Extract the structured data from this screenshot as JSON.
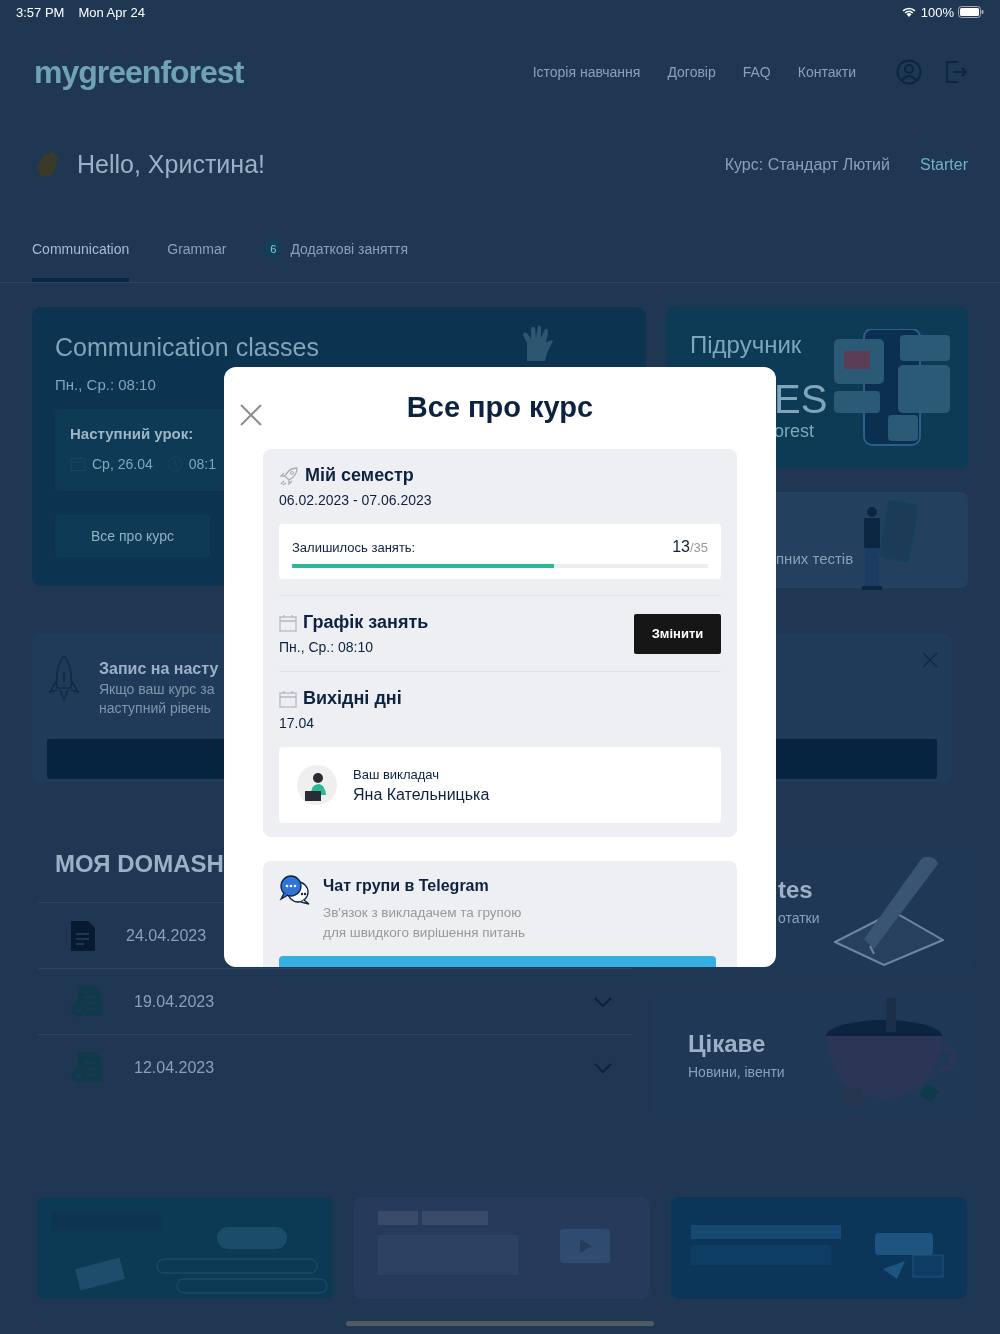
{
  "status_bar": {
    "time": "3:57 PM",
    "date": "Mon Apr 24",
    "battery": "100%"
  },
  "header": {
    "logo": "mygreenforest",
    "nav": [
      "Історія навчання",
      "Договір",
      "FAQ",
      "Контакти"
    ]
  },
  "greeting": {
    "text": "Hello, Христина!",
    "course": "Курс: Стандарт Лютий",
    "level": "Starter"
  },
  "tabs": [
    {
      "label": "Communication",
      "selected": true
    },
    {
      "label": "Grammar",
      "selected": false
    },
    {
      "label": "Додаткові заняття",
      "selected": false,
      "badge": "6"
    }
  ],
  "classes_card": {
    "title": "Communication classes",
    "schedule": "Пн., Ср.: 08:10",
    "next_label": "Наступний урок:",
    "next_date": "Ср, 26.04",
    "next_time": "08:1",
    "button": "Все про курс"
  },
  "textbook_card": {
    "title": "Підручник",
    "big_text": "ES",
    "small_text": "orest"
  },
  "tests_card": {
    "text": "пних тестів"
  },
  "enroll_banner": {
    "title": "Запис на насту",
    "lines": [
      "Якщо ваш курс за",
      "наступний рівень"
    ]
  },
  "homework": {
    "title": "МОЯ DOMASH",
    "rows": [
      {
        "date": "24.04.2023",
        "kind": "new"
      },
      {
        "date": "19.04.2023",
        "kind": "done"
      },
      {
        "date": "12.04.2023",
        "kind": "done"
      }
    ]
  },
  "notes_card": {
    "title": "tes",
    "subtitle": "отатки"
  },
  "news_card": {
    "title": "Цікаве",
    "subtitle": "Новини, івенти"
  },
  "modal": {
    "title": "Все про курс",
    "semester": {
      "title": "Мій семестр",
      "dates": "06.02.2023 - 07.06.2023",
      "remaining_label": "Залишилось занять:",
      "count": "13",
      "total": "/35",
      "level": 0.63
    },
    "schedule": {
      "title": "Графік занять",
      "value": "Пн., Ср.: 08:10",
      "button": "Змінити"
    },
    "holidays": {
      "title": "Вихідні дні",
      "value": "17.04"
    },
    "teacher": {
      "label": "Ваш викладач",
      "name": "Яна Кательницька"
    },
    "telegram": {
      "title": "Чат групи в Telegram",
      "description": "Зв'язок з викладачем та групою для швидкого вирішення питань"
    }
  }
}
